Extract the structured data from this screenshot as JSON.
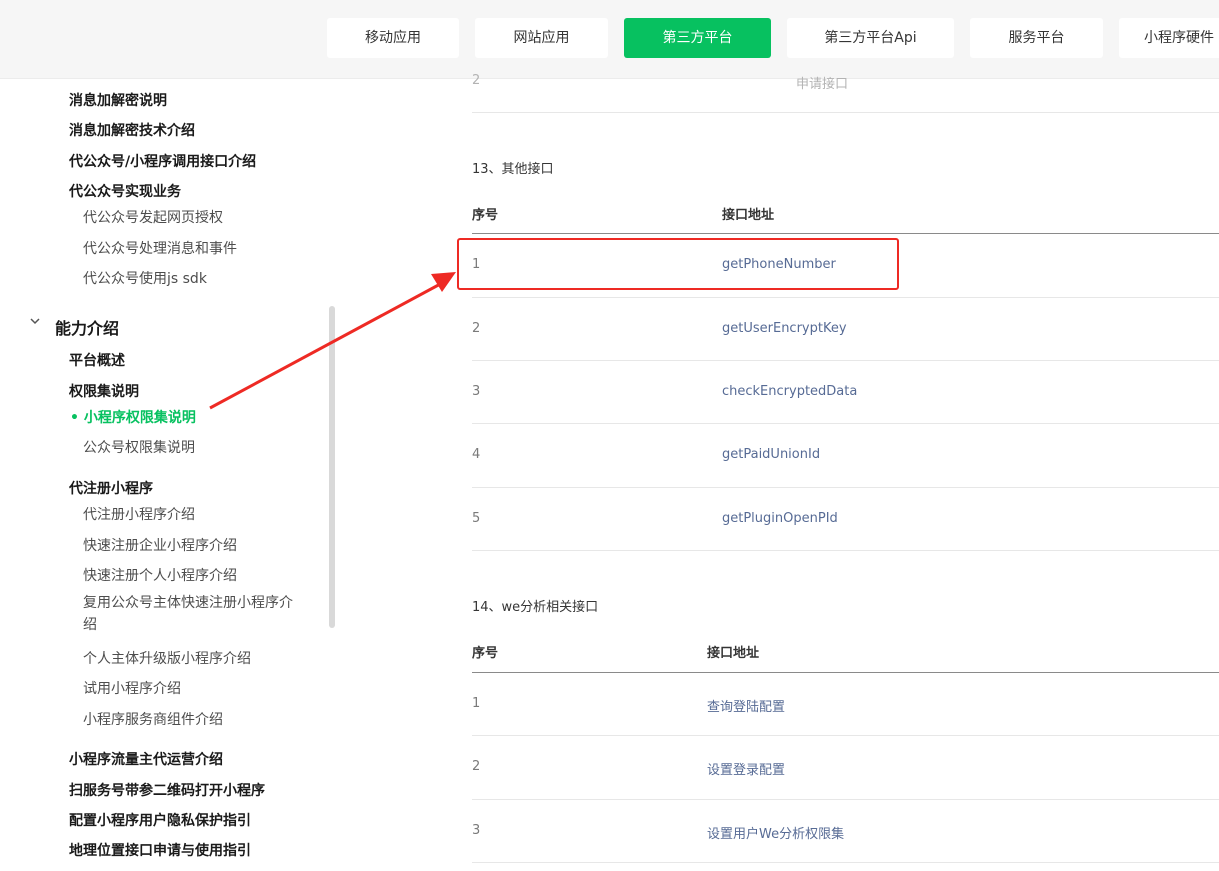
{
  "topnav": {
    "tabs": [
      {
        "label": "移动应用"
      },
      {
        "label": "网站应用"
      },
      {
        "label": "第三方平台"
      },
      {
        "label": "第三方平台Api"
      },
      {
        "label": "服务平台"
      },
      {
        "label": "小程序硬件"
      }
    ],
    "active_index": 2
  },
  "sidebar": {
    "items_top": [
      "消息加解密说明",
      "消息加解密技术介绍",
      "代公众号/小程序调用接口介绍",
      "代公众号实现业务"
    ],
    "sub_top": [
      "代公众号发起网页授权",
      "代公众号处理消息和事件",
      "代公众号使用js sdk"
    ],
    "section_title": "能力介绍",
    "section_items": [
      "平台概述",
      "权限集说明"
    ],
    "active_item": "小程序权限集说明",
    "sub_perm": "公众号权限集说明",
    "register_title": "代注册小程序",
    "register_items": [
      "代注册小程序介绍",
      "快速注册企业小程序介绍",
      "快速注册个人小程序介绍",
      "复用公众号主体快速注册小程序介绍",
      "个人主体升级版小程序介绍",
      "试用小程序介绍",
      "小程序服务商组件介绍"
    ],
    "bottom_items": [
      "小程序流量主代运营介绍",
      "扫服务号带参二维码打开小程序",
      "配置小程序用户隐私保护指引",
      "地理位置接口申请与使用指引"
    ]
  },
  "content": {
    "prev_row": {
      "num": "2",
      "name": "申请接口"
    },
    "sections": [
      {
        "title": "13、其他接口",
        "col_num": "序号",
        "col_addr": "接口地址",
        "rows": [
          {
            "num": "1",
            "name": "getPhoneNumber"
          },
          {
            "num": "2",
            "name": "getUserEncryptKey"
          },
          {
            "num": "3",
            "name": "checkEncryptedData"
          },
          {
            "num": "4",
            "name": "getPaidUnionId"
          },
          {
            "num": "5",
            "name": "getPluginOpenPId"
          }
        ]
      },
      {
        "title": "14、we分析相关接口",
        "col_num": "序号",
        "col_addr": "接口地址",
        "rows": [
          {
            "num": "1",
            "name": "查询登陆配置"
          },
          {
            "num": "2",
            "name": "设置登录配置"
          },
          {
            "num": "3",
            "name": "设置用户We分析权限集"
          }
        ]
      }
    ]
  },
  "colors": {
    "accent": "#07c160",
    "link": "#576b95",
    "annotation": "#ee2a24"
  }
}
